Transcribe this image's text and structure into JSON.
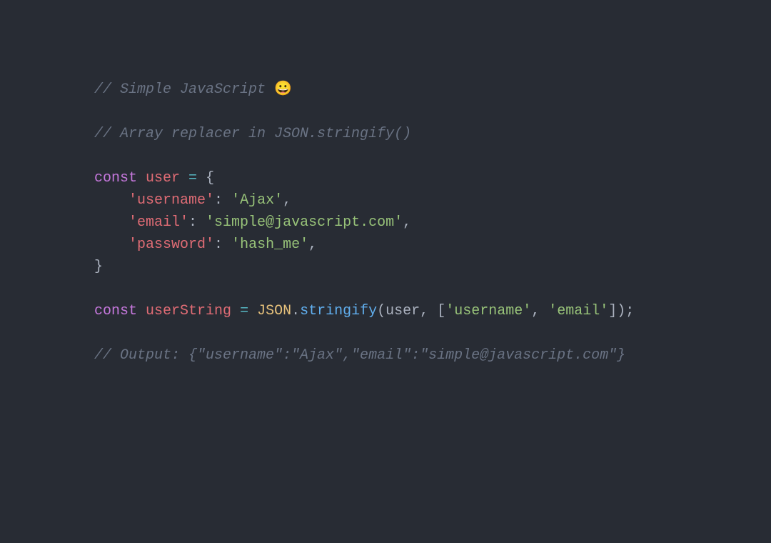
{
  "code": {
    "comment1_text": "// Simple JavaScript ",
    "comment1_emoji": "😀",
    "comment2": "// Array replacer in JSON.stringify()",
    "kw_const1": "const",
    "var_user": "user",
    "eq": " = ",
    "brace_open": "{",
    "indent": "    ",
    "key_username": "'username'",
    "colon": ": ",
    "val_username": "'Ajax'",
    "comma": ",",
    "key_email": "'email'",
    "val_email": "'simple@javascript.com'",
    "key_password": "'password'",
    "val_password": "'hash_me'",
    "brace_close": "}",
    "kw_const2": "const",
    "var_userString": "userString",
    "builtin_json": "JSON",
    "dot": ".",
    "method_stringify": "stringify",
    "paren_open": "(",
    "arg_user": "user",
    "arg_sep": ", ",
    "bracket_open": "[",
    "arr_username": "'username'",
    "arr_sep": ", ",
    "arr_email": "'email'",
    "bracket_close": "]",
    "paren_close": ")",
    "semicolon": ";",
    "comment3": "// Output: {\"username\":\"Ajax\",\"email\":\"simple@javascript.com\"}"
  }
}
